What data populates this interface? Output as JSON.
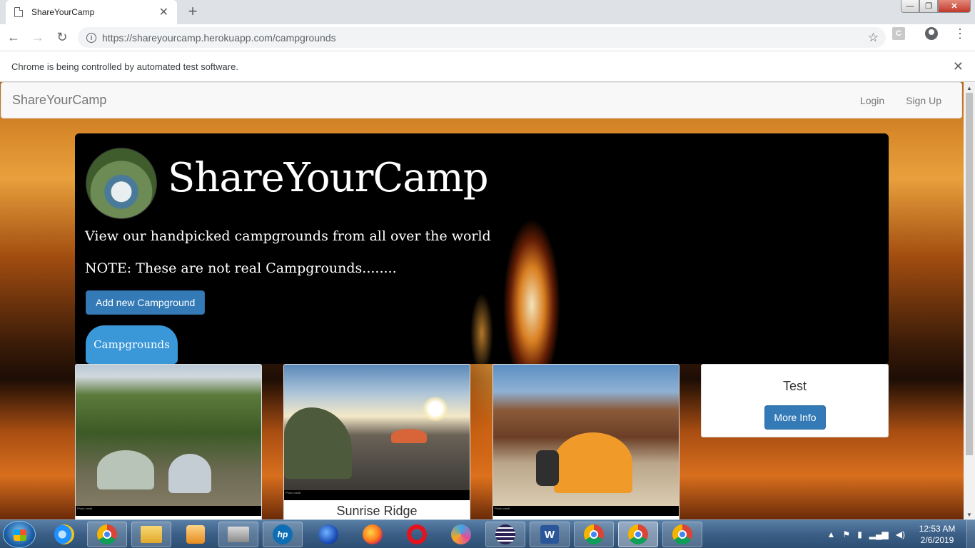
{
  "browser": {
    "tab_title": "ShareYourCamp",
    "tab_close": "✕",
    "new_tab": "+",
    "url": "https://shareyourcamp.herokuapp.com/campgrounds",
    "ext_letter": "C",
    "infobar_text": "Chrome is being controlled by automated test software.",
    "infobar_close": "✕",
    "window_controls": {
      "minimize": "—",
      "restore": "❐",
      "close": "✕"
    },
    "nav": {
      "back": "←",
      "forward": "→",
      "reload": "↻",
      "star": "☆",
      "menu": "⋮",
      "info": "i"
    }
  },
  "site": {
    "brand": "ShareYourCamp",
    "nav_links": [
      "Login",
      "Sign Up"
    ],
    "jumbotron": {
      "title": "ShareYourCamp",
      "subtitle": "View our handpicked campgrounds from all over the world",
      "note": "NOTE: These are not real Campgrounds........",
      "add_button": "Add new Campground",
      "campgrounds_button": "Campgrounds"
    },
    "cards": [
      {
        "caption": "",
        "credit": "Photo credit"
      },
      {
        "caption": "Sunrise Ridge",
        "credit": "Photo credit"
      },
      {
        "caption": "",
        "credit": "Photo credit"
      }
    ],
    "test_card": {
      "title": "Test",
      "button": "More Info"
    }
  },
  "taskbar": {
    "apps": [
      "start",
      "internet-explorer",
      "chrome",
      "file-explorer",
      "media-player",
      "toolbox",
      "hp-app",
      "thunderbird",
      "firefox",
      "opera",
      "app-swirl",
      "eclipse",
      "word",
      "chrome",
      "chrome",
      "chrome"
    ],
    "clock_time": "12:53 AM",
    "clock_date": "2/6/2019",
    "tray_up": "▲",
    "tray_icons": [
      "flag-icon",
      "battery-icon",
      "network-icon",
      "volume-icon"
    ]
  },
  "scrollbar": {
    "up": "▲",
    "down": "▼"
  }
}
